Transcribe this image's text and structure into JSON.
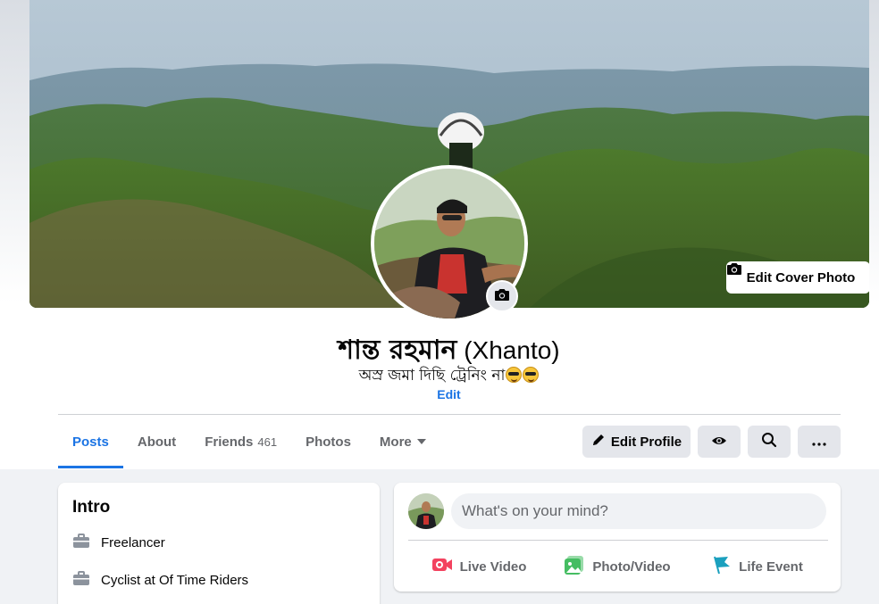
{
  "cover": {
    "edit_label": "Edit Cover Photo"
  },
  "profile": {
    "name": "শান্ত রহমান",
    "alt_name": "(Xhanto)",
    "bio": "অস্র জমা দিছি ট্রেনিং না",
    "edit_bio_label": "Edit"
  },
  "tabs": [
    {
      "label": "Posts",
      "active": true
    },
    {
      "label": "About"
    },
    {
      "label": "Friends",
      "count": "461"
    },
    {
      "label": "Photos"
    },
    {
      "label": "More"
    }
  ],
  "actions": {
    "edit_profile_label": "Edit Profile"
  },
  "intro": {
    "title": "Intro",
    "items": [
      {
        "icon": "briefcase-icon",
        "text": "Freelancer"
      },
      {
        "icon": "briefcase-icon",
        "text": "Cyclist at Of Time Riders"
      }
    ]
  },
  "composer": {
    "placeholder": "What's on your mind?",
    "actions": [
      {
        "icon": "live-video-icon",
        "label": "Live Video",
        "color": "#f3425f"
      },
      {
        "icon": "photo-video-icon",
        "label": "Photo/Video",
        "color": "#45bd62"
      },
      {
        "icon": "flag-icon",
        "label": "Life Event",
        "color": "#1ba0be"
      }
    ]
  },
  "colors": {
    "accent": "#1b74e4",
    "page_bg": "#f0f2f5"
  }
}
